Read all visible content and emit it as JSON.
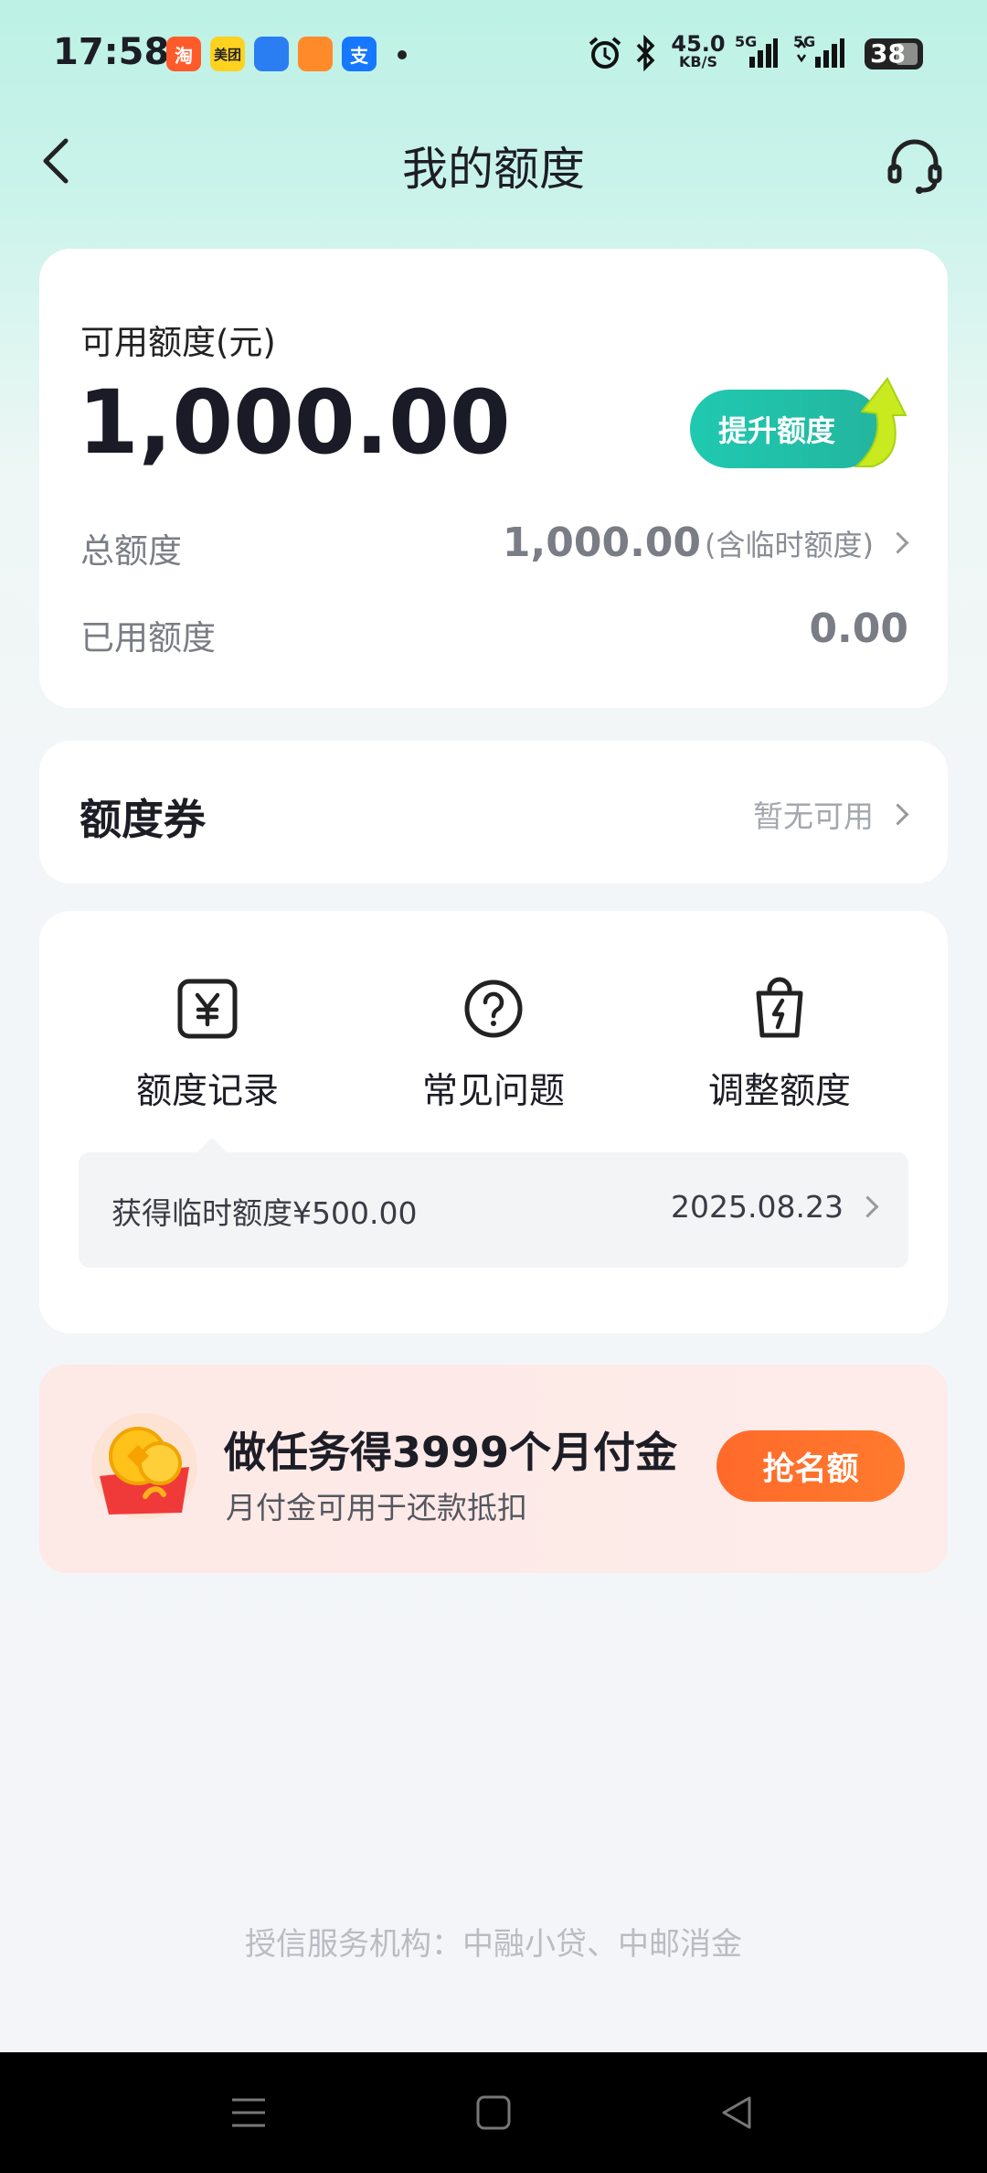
{
  "status_bar": {
    "time": "17:58",
    "apps": [
      "淘",
      "美团",
      "",
      "",
      "支"
    ],
    "net_speed": "45.0",
    "net_unit": "KB/S",
    "signal1": "5G",
    "signal2": "5G",
    "battery": "38"
  },
  "header": {
    "title": "我的额度"
  },
  "quota_card": {
    "available_label": "可用额度(元)",
    "available_amount": "1,000.00",
    "boost_label": "提升额度",
    "total_label": "总额度",
    "total_amount": "1,000.00",
    "total_note": "(含临时额度)",
    "used_label": "已用额度",
    "used_amount": "0.00"
  },
  "coupon_card": {
    "title": "额度券",
    "status": "暂无可用"
  },
  "quick_actions": {
    "items": [
      {
        "label": "额度记录",
        "icon": "yuan-square-icon"
      },
      {
        "label": "常见问题",
        "icon": "question-circle-icon"
      },
      {
        "label": "调整额度",
        "icon": "bolt-bag-icon"
      }
    ],
    "record": {
      "text": "获得临时额度¥500.00",
      "date": "2025.08.23"
    }
  },
  "promo": {
    "title": "做任务得3999个月付金",
    "subtitle": "月付金可用于还款抵扣",
    "button": "抢名额"
  },
  "footer": {
    "text": "授信服务机构：中融小贷、中邮消金"
  },
  "colors": {
    "accent_teal": "#22c2ab",
    "accent_orange": "#ff6f2c",
    "bg_top": "#bdf1e5"
  }
}
